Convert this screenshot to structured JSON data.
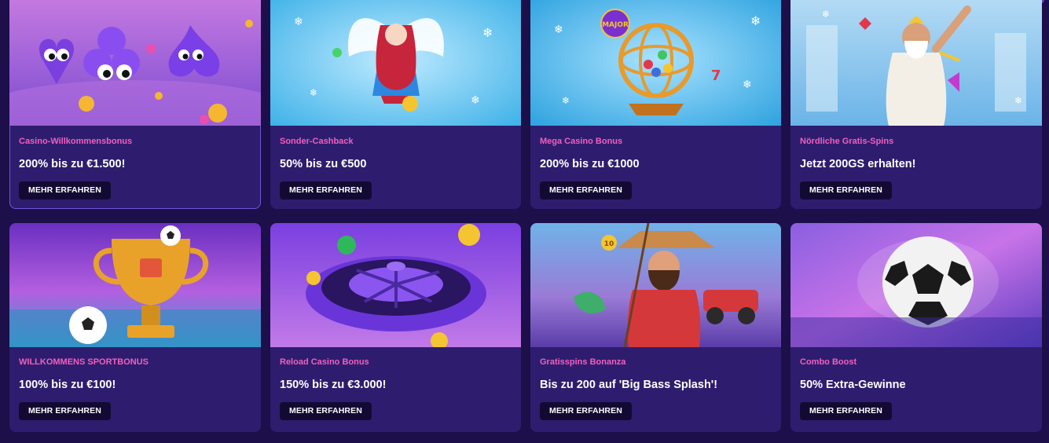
{
  "cards": [
    {
      "category": "Casino-Willkommensbonus",
      "headline": "200% bis zu €1.500!",
      "cta": "MEHR ERFAHREN",
      "art": "card-suits-characters-illustration"
    },
    {
      "category": "Sonder-Cashback",
      "headline": "50% bis zu €500",
      "cta": "MEHR ERFAHREN",
      "art": "winged-anime-girl-illustration"
    },
    {
      "category": "Mega Casino Bonus",
      "headline": "200% bis zu €1000",
      "cta": "MEHR ERFAHREN",
      "art": "bingo-cage-illustration",
      "badge": "MAJOR"
    },
    {
      "category": "Nördliche Gratis-Spins",
      "headline": "Jetzt 200GS erhalten!",
      "cta": "MEHR ERFAHREN",
      "art": "zeus-illustration"
    },
    {
      "category": "WILLKOMMENS SPORTBONUS",
      "headline": "100% bis zu €100!",
      "cta": "MEHR ERFAHREN",
      "art": "trophy-football-illustration"
    },
    {
      "category": "Reload Casino Bonus",
      "headline": "150% bis zu €3.000!",
      "cta": "MEHR ERFAHREN",
      "art": "roulette-wheel-illustration"
    },
    {
      "category": "Gratisspins Bonanza",
      "headline": "Bis zu 200 auf 'Big Bass Splash'!",
      "cta": "MEHR ERFAHREN",
      "art": "fisherman-illustration",
      "badge": "10"
    },
    {
      "category": "Combo Boost",
      "headline": "50% Extra-Gewinne",
      "cta": "MEHR ERFAHREN",
      "art": "football-illustration"
    }
  ],
  "colors": {
    "page_bg": "#1c0f4a",
    "card_bg": "#2e1d6e",
    "category": "#f25fbf",
    "headline": "#ffffff",
    "button_bg": "#130a33"
  }
}
